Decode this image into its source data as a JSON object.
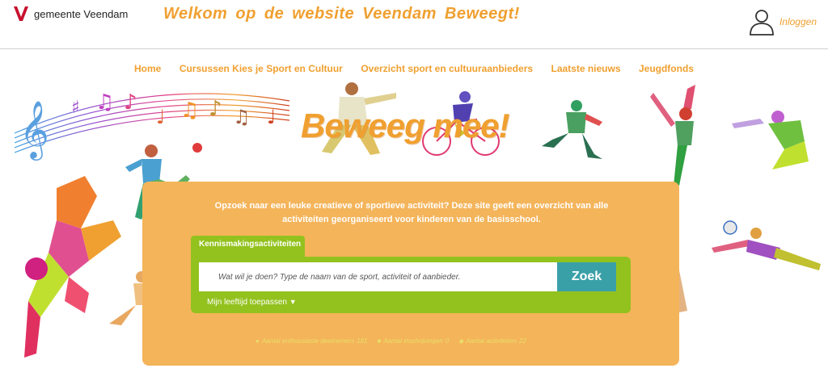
{
  "header": {
    "logo_text": "gemeente Veendam",
    "title": "Welkom op de website Veendam Beweegt!",
    "login_label": "Inloggen"
  },
  "nav": {
    "items": [
      {
        "label": "Home"
      },
      {
        "label": "Cursussen Kies je Sport en Cultuur"
      },
      {
        "label": "Overzicht sport en cultuuraanbieders"
      },
      {
        "label": "Laatste nieuws"
      },
      {
        "label": "Jeugdfonds"
      }
    ]
  },
  "hero": {
    "slogan": "Beweeg mee!",
    "intro": "Opzoek naar een leuke creatieve of sportieve activiteit? Deze site geeft een overzicht van alle activiteiten georganiseerd voor kinderen van de basisschool.",
    "tab_label": "Kennismakingsactiviteiten",
    "search_placeholder": "Wat wil je doen? Type de naam van de sport, activiteit of aanbieder.",
    "search_button": "Zoek",
    "age_toggle": "Mijn leeftijd toepassen",
    "stats": [
      {
        "label": "Aantal enthousiaste deelnemers",
        "value": "181"
      },
      {
        "label": "Aantal inschrijvingen",
        "value": "0"
      },
      {
        "label": "Aantal activiteiten",
        "value": "22"
      }
    ]
  },
  "colors": {
    "accent": "#f0a030",
    "panel": "#f4b45a",
    "green": "#93c21e",
    "button": "#3aa0a8",
    "logo_red": "#c8102e"
  }
}
